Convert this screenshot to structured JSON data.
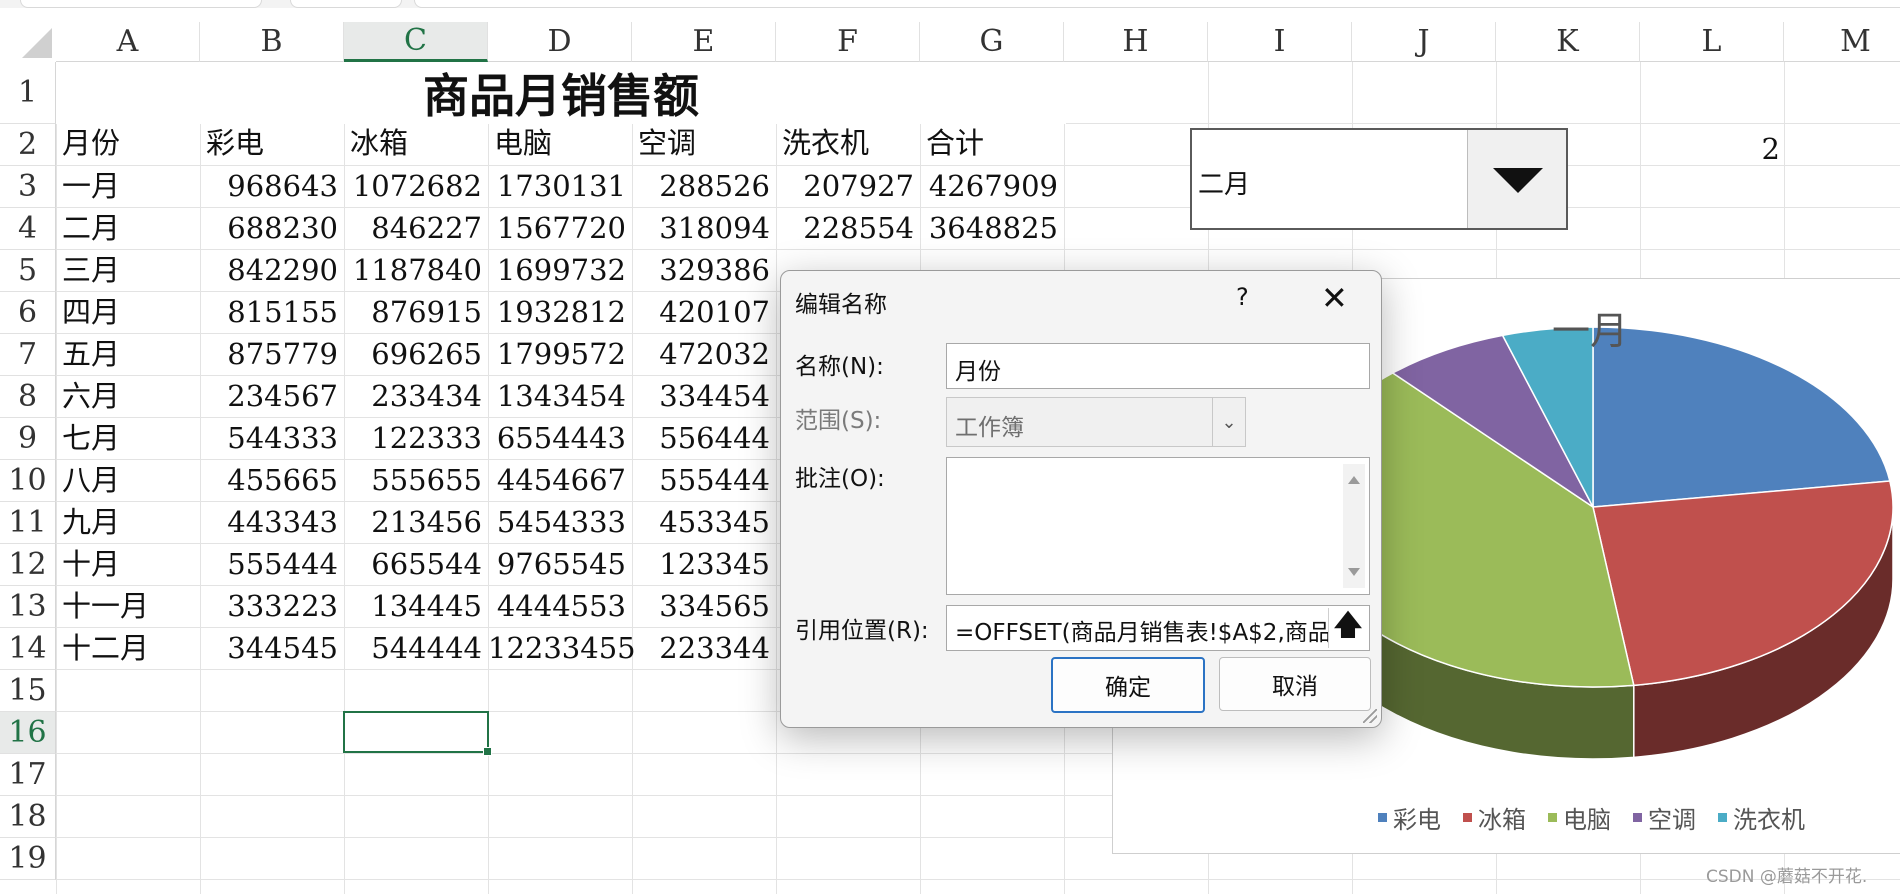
{
  "columns": [
    "A",
    "B",
    "C",
    "D",
    "E",
    "F",
    "G",
    "H",
    "I",
    "J",
    "K",
    "L",
    "M"
  ],
  "selected_column": "C",
  "rows": [
    "1",
    "2",
    "3",
    "4",
    "5",
    "6",
    "7",
    "8",
    "9",
    "10",
    "11",
    "12",
    "13",
    "14",
    "15",
    "16",
    "17",
    "18",
    "19"
  ],
  "selected_row": "16",
  "sheet": {
    "title": "商品月销售额",
    "headers": [
      "月份",
      "彩电",
      "冰箱",
      "电脑",
      "空调",
      "洗衣机",
      "合计"
    ],
    "data": [
      [
        "一月",
        "968643",
        "1072682",
        "1730131",
        "288526",
        "207927",
        "4267909"
      ],
      [
        "二月",
        "688230",
        "846227",
        "1567720",
        "318094",
        "228554",
        "3648825"
      ],
      [
        "三月",
        "842290",
        "1187840",
        "1699732",
        "329386",
        "",
        ""
      ],
      [
        "四月",
        "815155",
        "876915",
        "1932812",
        "420107",
        "",
        ""
      ],
      [
        "五月",
        "875779",
        "696265",
        "1799572",
        "472032",
        "",
        ""
      ],
      [
        "六月",
        "234567",
        "233434",
        "1343454",
        "334454",
        "",
        ""
      ],
      [
        "七月",
        "544333",
        "122333",
        "6554443",
        "556444",
        "",
        ""
      ],
      [
        "八月",
        "455665",
        "555655",
        "4454667",
        "555444",
        "",
        ""
      ],
      [
        "九月",
        "443343",
        "213456",
        "5454333",
        "453345",
        "",
        ""
      ],
      [
        "十月",
        "555444",
        "665544",
        "9765545",
        "123345",
        "",
        ""
      ],
      [
        "十一月",
        "333223",
        "134445",
        "4444553",
        "334565",
        "",
        ""
      ],
      [
        "十二月",
        "344545",
        "544444",
        "12233455",
        "223344",
        "",
        ""
      ]
    ],
    "l2_value": "2"
  },
  "combo": {
    "value": "二月"
  },
  "chart": {
    "title": "一月",
    "legend": [
      {
        "name": "彩电",
        "color": "#4f81bd"
      },
      {
        "name": "冰箱",
        "color": "#c0504d"
      },
      {
        "name": "电脑",
        "color": "#9bbb59"
      },
      {
        "name": "空调",
        "color": "#8064a2"
      },
      {
        "name": "洗衣机",
        "color": "#4bacc6"
      }
    ]
  },
  "chart_data": {
    "type": "pie",
    "title": "一月",
    "categories": [
      "彩电",
      "冰箱",
      "电脑",
      "空调",
      "洗衣机"
    ],
    "values": [
      968643,
      1072682,
      1730131,
      288526,
      207927
    ]
  },
  "dialog": {
    "title": "编辑名称",
    "help": "?",
    "close": "✕",
    "name_label": "名称(N):",
    "name_value": "月份",
    "scope_label": "范围(S):",
    "scope_value": "工作簿",
    "comment_label": "批注(O):",
    "ref_label": "引用位置(R):",
    "ref_value": "=OFFSET(商品月销售表!$A$2,商品",
    "ok": "确定",
    "cancel": "取消"
  },
  "watermark": "CSDN @蘑菇不开花."
}
